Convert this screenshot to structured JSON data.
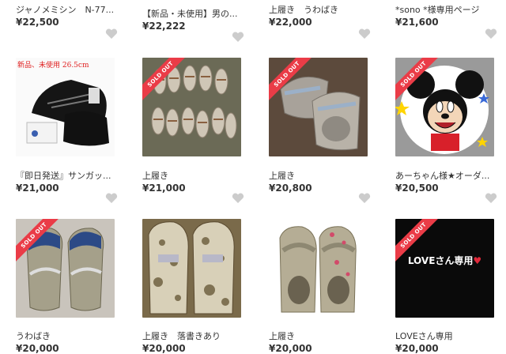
{
  "items": [
    {
      "name": "ジャノメミシン　N-77...",
      "price": "¥22,500"
    },
    {
      "name": "【新品・未使用】男の...",
      "price": "¥22,222"
    },
    {
      "name": "上履き　うわばき",
      "price": "¥22,000"
    },
    {
      "name": "*sono *様専用ページ",
      "price": "¥21,600"
    },
    {
      "name": "『即日発送』サンガッ...",
      "price": "¥21,000",
      "sold_out": false,
      "image_text": "新品、未使用 26.5cm"
    },
    {
      "name": "上履き",
      "price": "¥21,000",
      "sold_out": true
    },
    {
      "name": "上履き",
      "price": "¥20,800",
      "sold_out": true
    },
    {
      "name": "あーちゃん様★オーダ...",
      "price": "¥20,500",
      "sold_out": true
    },
    {
      "name": "うわばき",
      "price": "¥20,000",
      "sold_out": true
    },
    {
      "name": "上履き　落書きあり",
      "price": "¥20,000",
      "sold_out": false
    },
    {
      "name": "上履き",
      "price": "¥20,000",
      "sold_out": false
    },
    {
      "name": "LOVEさん専用",
      "price": "¥20,000",
      "sold_out": true,
      "image_text": "LOVEさん専用"
    }
  ],
  "sold_out_label": "SOLD OUT",
  "colors": {
    "sold_band": "#ea3c47",
    "heart": "#cccccc",
    "text": "#333333"
  }
}
